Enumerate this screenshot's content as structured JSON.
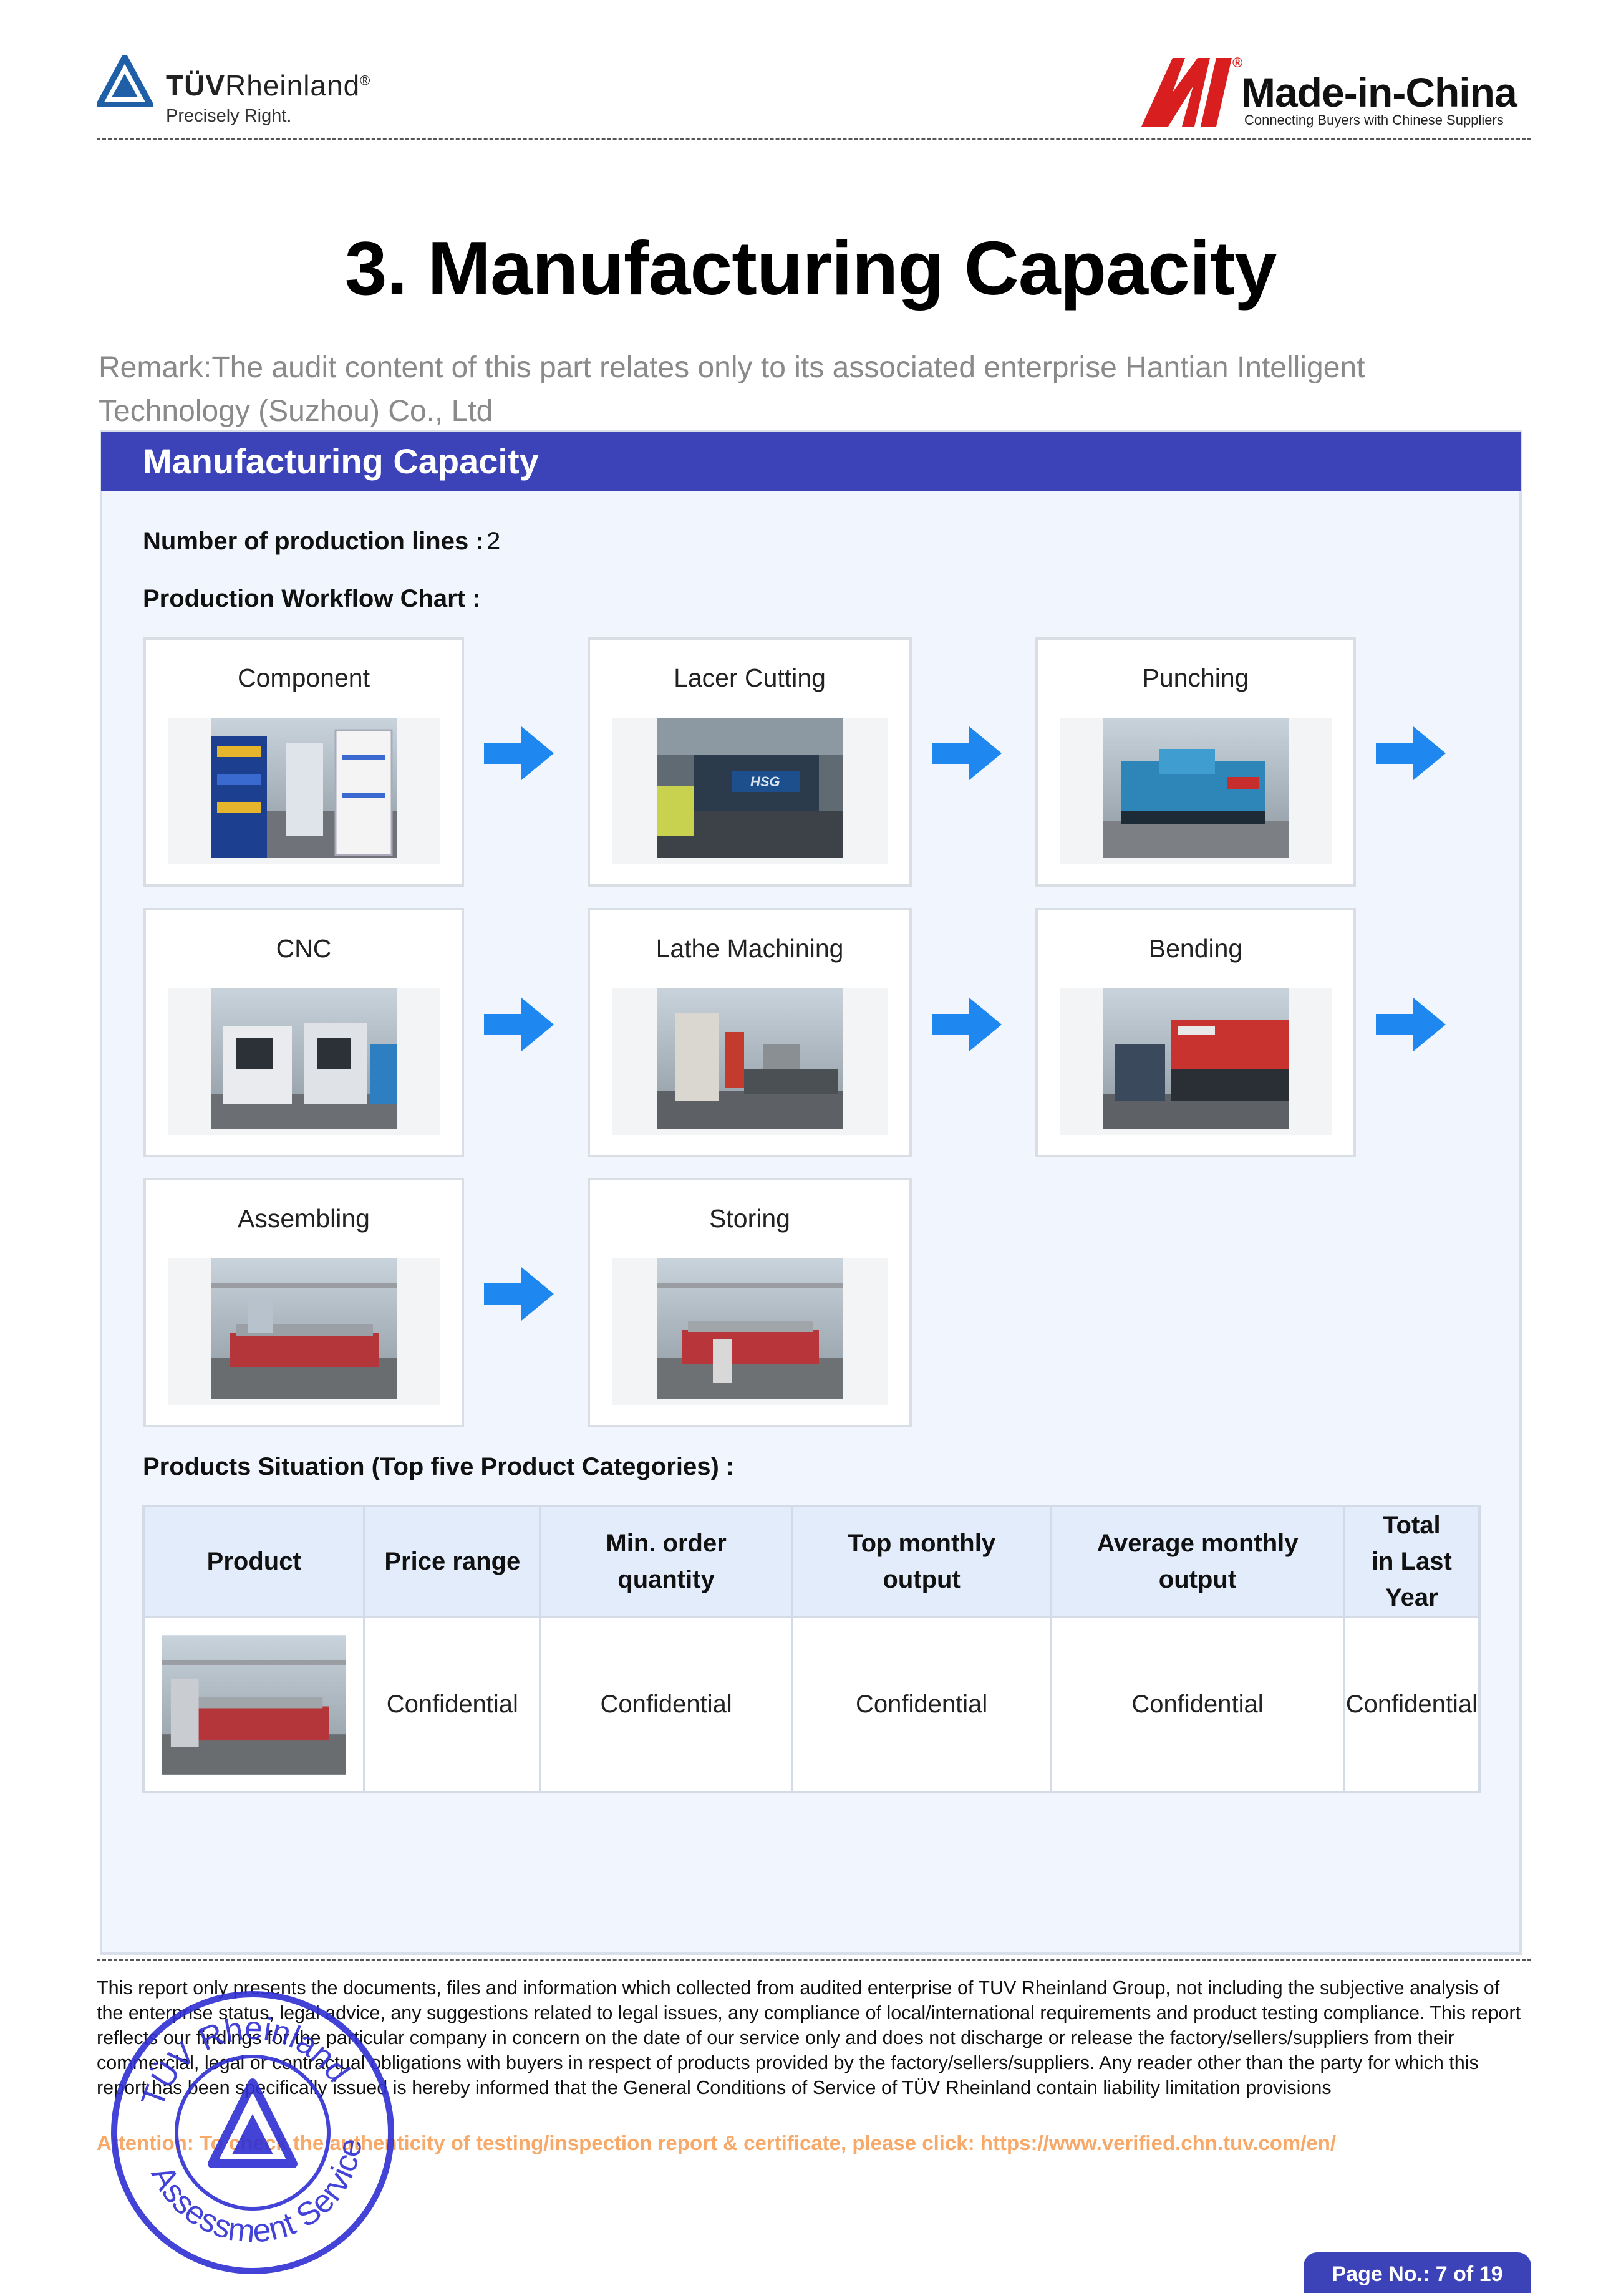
{
  "header": {
    "tuv_brand_bold": "TÜV",
    "tuv_brand_rest": "Rheinland",
    "tuv_registered": "®",
    "tuv_tagline": "Precisely Right.",
    "mic_brand": "Made-in-China",
    "mic_registered": "®",
    "mic_tagline": "Connecting Buyers with Chinese Suppliers"
  },
  "title": "3. Manufacturing Capacity",
  "remark": "Remark:The audit content of this part relates only to its associated enterprise Hantian Intelligent Technology (Suzhou) Co., Ltd",
  "section": {
    "title": "Manufacturing Capacity",
    "production_lines_label": "Number of production lines :",
    "production_lines_value": "2",
    "workflow_label": "Production Workflow Chart :",
    "workflow_steps": [
      {
        "label": "Component"
      },
      {
        "label": "Lacer Cutting"
      },
      {
        "label": "Punching"
      },
      {
        "label": "CNC"
      },
      {
        "label": "Lathe Machining"
      },
      {
        "label": "Bending"
      },
      {
        "label": "Assembling"
      },
      {
        "label": "Storing"
      }
    ],
    "products_label": "Products Situation (Top five Product Categories) :",
    "table": {
      "headers": [
        "Product",
        "Price range",
        "Min. order quantity",
        "Top monthly output",
        "Average monthly output",
        "Total in Last Year"
      ],
      "rows": [
        {
          "price_range": "Confidential",
          "min_order": "Confidential",
          "top_monthly": "Confidential",
          "avg_monthly": "Confidential",
          "total_last_year": "Confidential"
        }
      ]
    }
  },
  "footer": {
    "disclaimer": "This report only presents the documents, files and information which collected from audited enterprise of TUV Rheinland Group, not including the subjective analysis of the enterprise status, legal advice, any suggestions related to legal issues, any compliance of local/international requirements and product testing compliance. This report reflects our findings for the particular company in concern on the date of our service only and does not discharge or release the factory/sellers/suppliers from their commercial, legal or contractual obligations with buyers in respect of products provided by the factory/sellers/suppliers. Any reader other than the party for which this report has been specifically issued is hereby informed that the General Conditions of Service of TÜV Rheinland contain liability limitation provisions",
    "attention": "Attention: To check the authenticity of testing/inspection report & certificate, please click:  https://www.verified.chn.tuv.com/en/",
    "stamp_text": "TÜV Rheinland Assessment Service",
    "page_no": "Page No.: 7 of 19"
  },
  "colors": {
    "brand_blue": "#3c43b9",
    "arrow_blue": "#1e88f0",
    "mic_red": "#d81e1e",
    "tuv_blue": "#1f5fa8"
  }
}
